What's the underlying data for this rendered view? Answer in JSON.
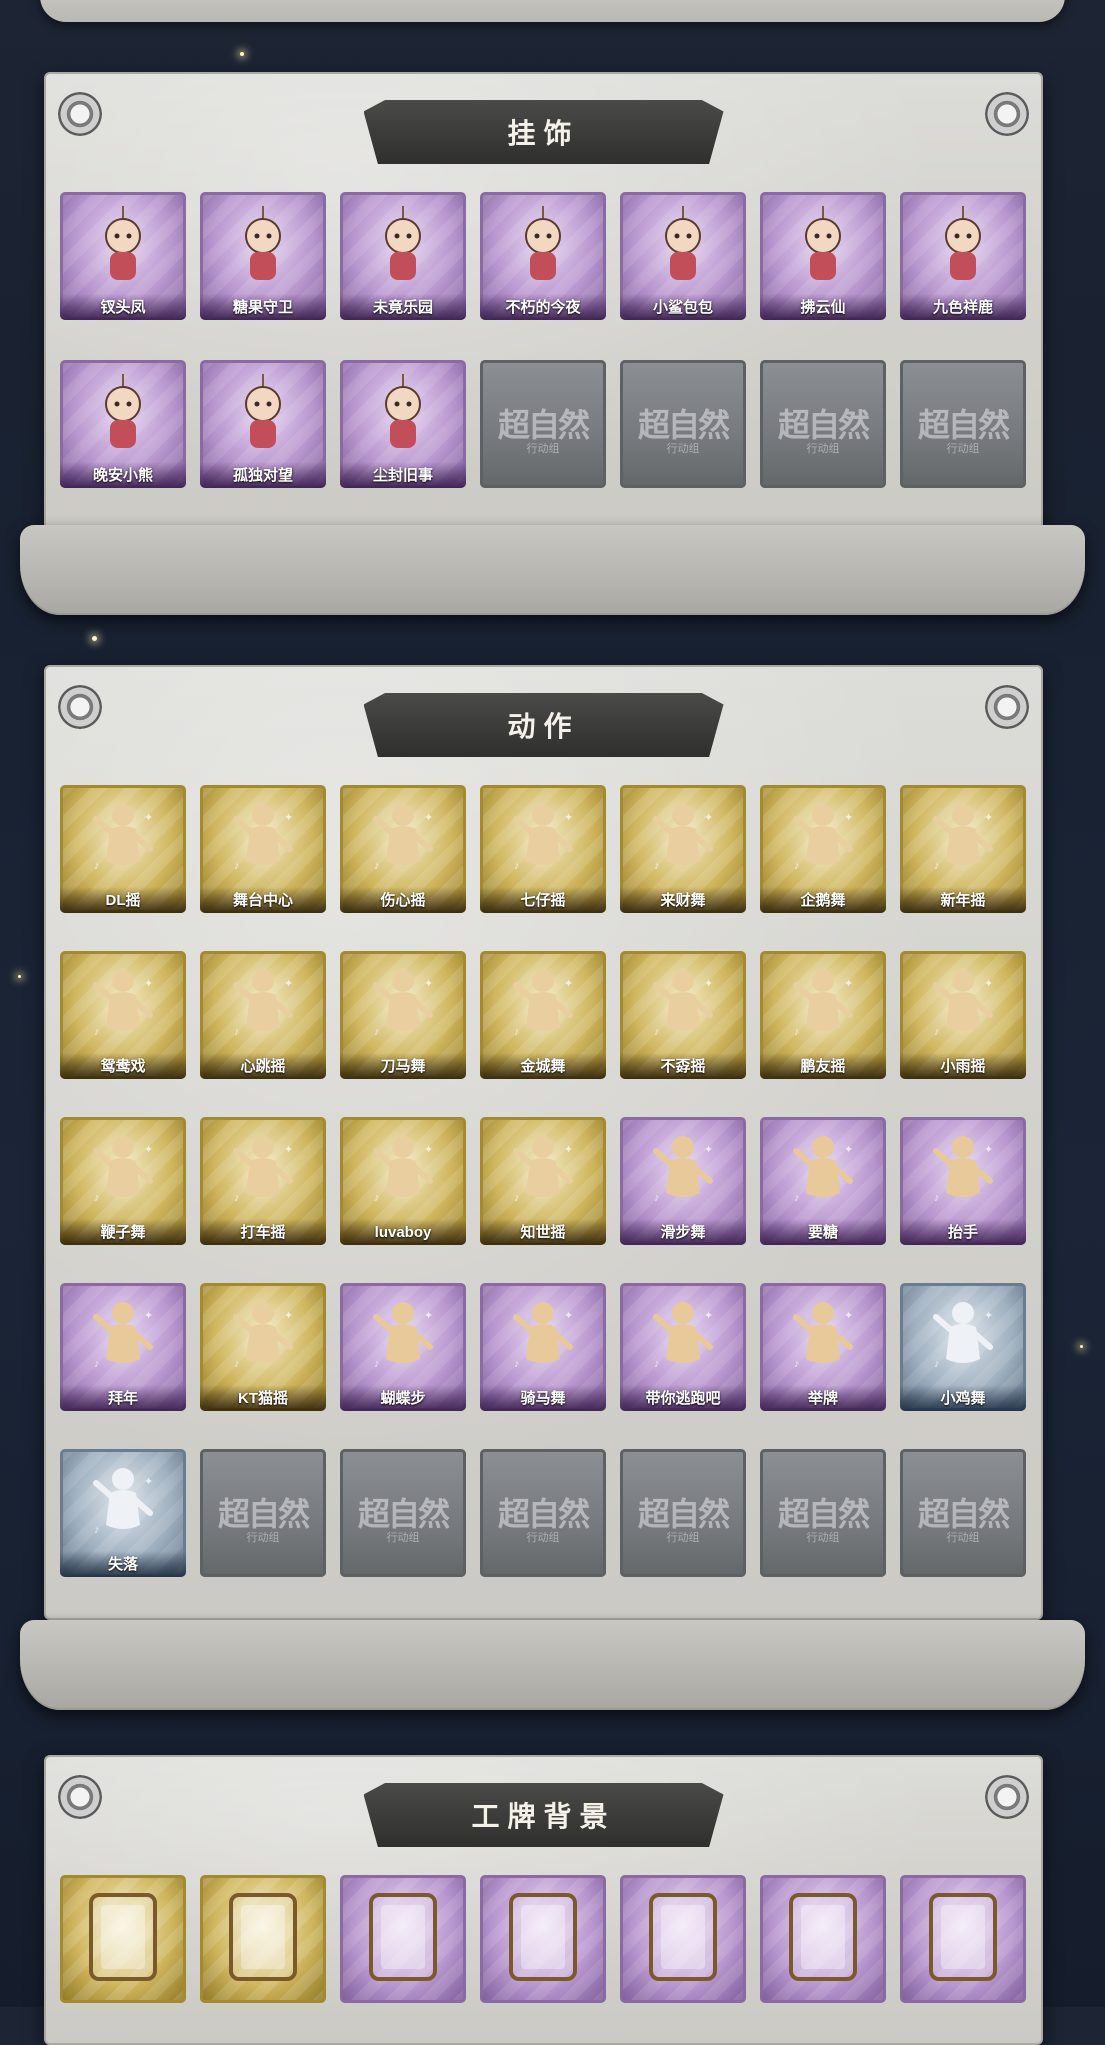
{
  "sections": {
    "charms": {
      "title": "挂饰",
      "items": [
        {
          "label": "钗头凤",
          "icon": "phoenix-crown-doll-icon",
          "rarity": "purple"
        },
        {
          "label": "糖果守卫",
          "icon": "pumpkin-guard-icon",
          "rarity": "purple"
        },
        {
          "label": "未竟乐园",
          "icon": "pink-hair-doll-icon",
          "rarity": "purple"
        },
        {
          "label": "不朽的今夜",
          "icon": "pink-cat-cup-icon",
          "rarity": "purple"
        },
        {
          "label": "小鲨包包",
          "icon": "shark-plush-icon",
          "rarity": "purple"
        },
        {
          "label": "拂云仙",
          "icon": "cloud-fairy-pendant-icon",
          "rarity": "purple"
        },
        {
          "label": "九色祥鹿",
          "icon": "deer-pendant-icon",
          "rarity": "purple"
        },
        {
          "label": "晚安小熊",
          "icon": "bear-plush-icon",
          "rarity": "purple"
        },
        {
          "label": "孤独对望",
          "icon": "white-hair-doll-icon",
          "rarity": "purple"
        },
        {
          "label": "尘封旧事",
          "icon": "dark-hair-doll-icon",
          "rarity": "purple"
        }
      ],
      "locked_count": 4
    },
    "emotes": {
      "title": "动作",
      "items": [
        {
          "label": "DL摇",
          "rarity": "gold"
        },
        {
          "label": "舞台中心",
          "rarity": "gold"
        },
        {
          "label": "伤心摇",
          "rarity": "gold"
        },
        {
          "label": "七仔摇",
          "rarity": "gold"
        },
        {
          "label": "来财舞",
          "rarity": "gold"
        },
        {
          "label": "企鹅舞",
          "rarity": "gold"
        },
        {
          "label": "新年摇",
          "rarity": "gold"
        },
        {
          "label": "鸳鸯戏",
          "rarity": "gold"
        },
        {
          "label": "心跳摇",
          "rarity": "gold"
        },
        {
          "label": "刀马舞",
          "rarity": "gold"
        },
        {
          "label": "金城舞",
          "rarity": "gold"
        },
        {
          "label": "不孬摇",
          "rarity": "gold"
        },
        {
          "label": "鹏友摇",
          "rarity": "gold"
        },
        {
          "label": "小雨摇",
          "rarity": "gold"
        },
        {
          "label": "鞭子舞",
          "rarity": "gold"
        },
        {
          "label": "打车摇",
          "rarity": "gold"
        },
        {
          "label": "luvaboy",
          "rarity": "gold"
        },
        {
          "label": "知世摇",
          "rarity": "gold"
        },
        {
          "label": "滑步舞",
          "rarity": "purple"
        },
        {
          "label": "要糖",
          "rarity": "purple"
        },
        {
          "label": "抬手",
          "rarity": "purple"
        },
        {
          "label": "拜年",
          "rarity": "purple"
        },
        {
          "label": "KT猫摇",
          "rarity": "gold"
        },
        {
          "label": "蝴蝶步",
          "rarity": "purple"
        },
        {
          "label": "骑马舞",
          "rarity": "purple"
        },
        {
          "label": "带你逃跑吧",
          "rarity": "purple"
        },
        {
          "label": "举牌",
          "rarity": "purple"
        },
        {
          "label": "小鸡舞",
          "rarity": "blue"
        },
        {
          "label": "失落",
          "rarity": "blue"
        }
      ],
      "locked_count": 6
    },
    "badges": {
      "title": "工牌背景",
      "items": [
        {
          "rarity": "gold",
          "icon": "dark-red-frame-icon"
        },
        {
          "rarity": "gold",
          "icon": "ice-blue-frame-icon"
        },
        {
          "rarity": "purple",
          "icon": "rust-frame-icon"
        },
        {
          "rarity": "purple",
          "icon": "golden-glow-frame-icon"
        },
        {
          "rarity": "purple",
          "icon": "lavender-frame-icon"
        },
        {
          "rarity": "purple",
          "icon": "orange-frame-icon"
        },
        {
          "rarity": "purple",
          "icon": "gold-card-frame-icon"
        }
      ]
    }
  },
  "locked_watermark": {
    "main": "超自然",
    "sub": "行动组"
  },
  "colors": {
    "gold": "#cfb65e",
    "purple": "#b997cf",
    "blue": "#9fb0c0",
    "locked": "#767a7e",
    "banner": "#3a3a39"
  }
}
